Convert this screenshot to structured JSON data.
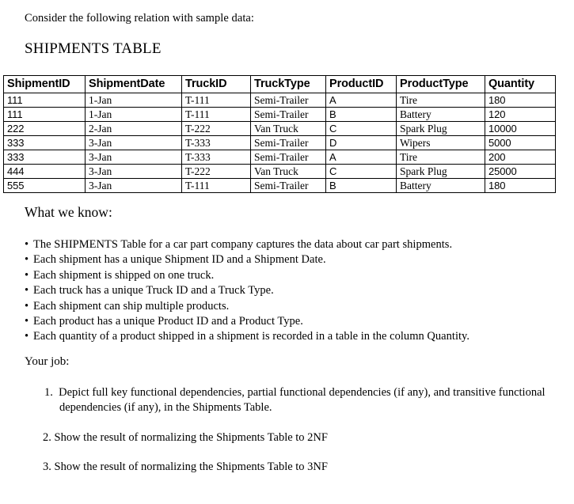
{
  "document": {
    "intro": "Consider the following relation with sample data:",
    "table_title": "SHIPMENTS TABLE"
  },
  "shipments_table": {
    "columns": [
      "ShipmentID",
      "ShipmentDate",
      "TruckID",
      "TruckType",
      "ProductID",
      "ProductType",
      "Quantity"
    ],
    "rows": [
      {
        "ShipmentID": "111",
        "ShipmentDate": "1-Jan",
        "TruckID": "T-111",
        "TruckType": "Semi-Trailer",
        "ProductID": "A",
        "ProductType": "Tire",
        "Quantity": "180"
      },
      {
        "ShipmentID": "111",
        "ShipmentDate": "1-Jan",
        "TruckID": "T-111",
        "TruckType": "Semi-Trailer",
        "ProductID": "B",
        "ProductType": "Battery",
        "Quantity": "120"
      },
      {
        "ShipmentID": "222",
        "ShipmentDate": "2-Jan",
        "TruckID": "T-222",
        "TruckType": "Van Truck",
        "ProductID": "C",
        "ProductType": "Spark Plug",
        "Quantity": "10000"
      },
      {
        "ShipmentID": "333",
        "ShipmentDate": "3-Jan",
        "TruckID": "T-333",
        "TruckType": "Semi-Trailer",
        "ProductID": "D",
        "ProductType": "Wipers",
        "Quantity": "5000"
      },
      {
        "ShipmentID": "333",
        "ShipmentDate": "3-Jan",
        "TruckID": "T-333",
        "TruckType": "Semi-Trailer",
        "ProductID": "A",
        "ProductType": "Tire",
        "Quantity": "200"
      },
      {
        "ShipmentID": "444",
        "ShipmentDate": "3-Jan",
        "TruckID": "T-222",
        "TruckType": "Van Truck",
        "ProductID": "C",
        "ProductType": "Spark Plug",
        "Quantity": "25000"
      },
      {
        "ShipmentID": "555",
        "ShipmentDate": "3-Jan",
        "TruckID": "T-111",
        "TruckType": "Semi-Trailer",
        "ProductID": "B",
        "ProductType": "Battery",
        "Quantity": "180"
      }
    ]
  },
  "what_we_know": {
    "heading": "What we know:",
    "bullet_char": "•",
    "items": [
      "The SHIPMENTS Table for a car part company captures the data about car part shipments.",
      "Each shipment has a unique Shipment ID and a Shipment Date.",
      "Each shipment is shipped on one truck.",
      "Each truck has a unique Truck ID and a Truck Type.",
      "Each shipment can ship multiple products.",
      "Each product has a unique Product ID and a Product Type.",
      "Each quantity of a product shipped in a shipment is recorded in a table in the column Quantity."
    ]
  },
  "your_job": {
    "heading": "Your job:",
    "items": [
      {
        "number": "1.",
        "text": "Depict full key functional dependencies, partial functional dependencies (if any), and transitive functional dependencies (if any), in the Shipments Table."
      },
      {
        "number": "2.",
        "text": "Show the result of normalizing the Shipments Table to 2NF"
      },
      {
        "number": "3.",
        "text": "Show the result of normalizing the Shipments Table to 3NF"
      }
    ]
  }
}
